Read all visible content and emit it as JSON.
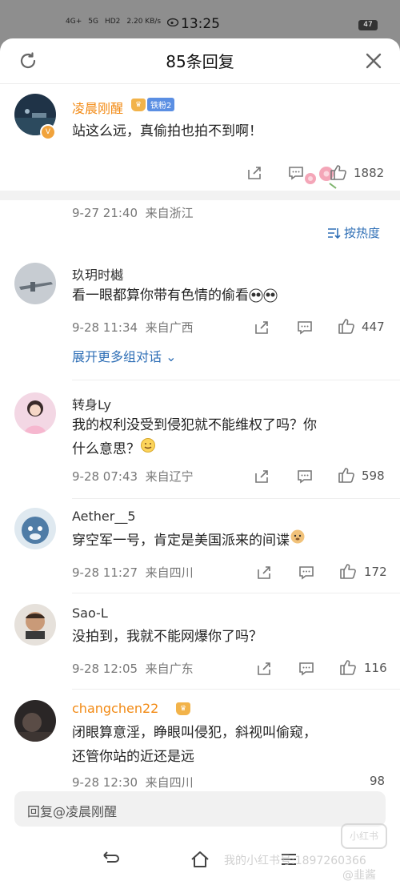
{
  "status_bar": {
    "signal1": "4G+",
    "signal2": "5G",
    "hd": "HD2",
    "speed": "2.20 KB/s",
    "time": "13:25",
    "battery": "47"
  },
  "header": {
    "title": "85条回复"
  },
  "root_comment": {
    "name": "凌晨刚醒",
    "fan_badge": "铁粉2",
    "text": "站这么远，真偷拍也拍不到啊！",
    "date": "9-27 21:40",
    "location": "来自浙江",
    "likes": "1882"
  },
  "sort_label": "按热度",
  "replies": [
    {
      "name": "玖玥时樾",
      "text": "看一眼都算你带有色情的偷看",
      "date": "9-28 11:34",
      "location": "来自广西",
      "likes": "447"
    },
    {
      "name": "转身Ly",
      "text_line1": "我的权利没受到侵犯就不能维权了吗？你",
      "text_line2": "什么意思？",
      "date": "9-28 07:43",
      "location": "来自辽宁",
      "likes": "598"
    },
    {
      "name": "Aether__5",
      "text": "穿空军一号，肯定是美国派来的间谍",
      "date": "9-28 11:27",
      "location": "来自四川",
      "likes": "172"
    },
    {
      "name": "Sao-L",
      "text": "没拍到，我就不能网爆你了吗？",
      "date": "9-28 12:05",
      "location": "来自广东",
      "likes": "116"
    },
    {
      "name": "changchen22",
      "text_line1": "闭眼算意淫，睁眼叫侵犯，斜视叫偷窥，",
      "text_line2": "还管你站的近还是远",
      "date": "9-28 12:30",
      "location": "来自四川",
      "likes": "98"
    }
  ],
  "expand_label": "展开更多组对话",
  "reply_placeholder": "回复@凌晨刚醒",
  "watermarks": {
    "logo": "小红书",
    "line1": "我的小红书号:1897260366",
    "line2": "@韭酱0003"
  },
  "colors": {
    "accent_blue": "#2f6fb6",
    "vip_orange": "#f28a14",
    "fan_blue": "#5b8fe3"
  }
}
